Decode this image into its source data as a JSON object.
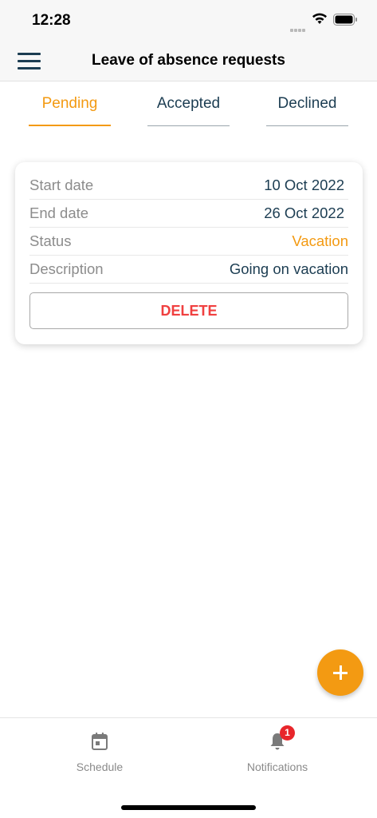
{
  "status_bar": {
    "time": "12:28"
  },
  "header": {
    "title": "Leave of absence requests"
  },
  "tabs": [
    {
      "label": "Pending"
    },
    {
      "label": "Accepted"
    },
    {
      "label": "Declined"
    }
  ],
  "request": {
    "rows": [
      {
        "label": "Start date",
        "value": "10 Oct 2022"
      },
      {
        "label": "End date",
        "value": "26 Oct 2022"
      },
      {
        "label": "Status",
        "value": "Vacation"
      },
      {
        "label": "Description",
        "value": "Going on vacation"
      }
    ],
    "delete_label": "DELETE"
  },
  "fab": {
    "icon": "plus-icon"
  },
  "bottom_nav": {
    "items": [
      {
        "label": "Schedule",
        "icon": "calendar-icon"
      },
      {
        "label": "Notifications",
        "icon": "bell-icon",
        "badge": "1"
      }
    ]
  },
  "colors": {
    "accent": "#f39a12",
    "text": "#1c3d52",
    "danger": "#f04040",
    "badge": "#e8262b"
  }
}
